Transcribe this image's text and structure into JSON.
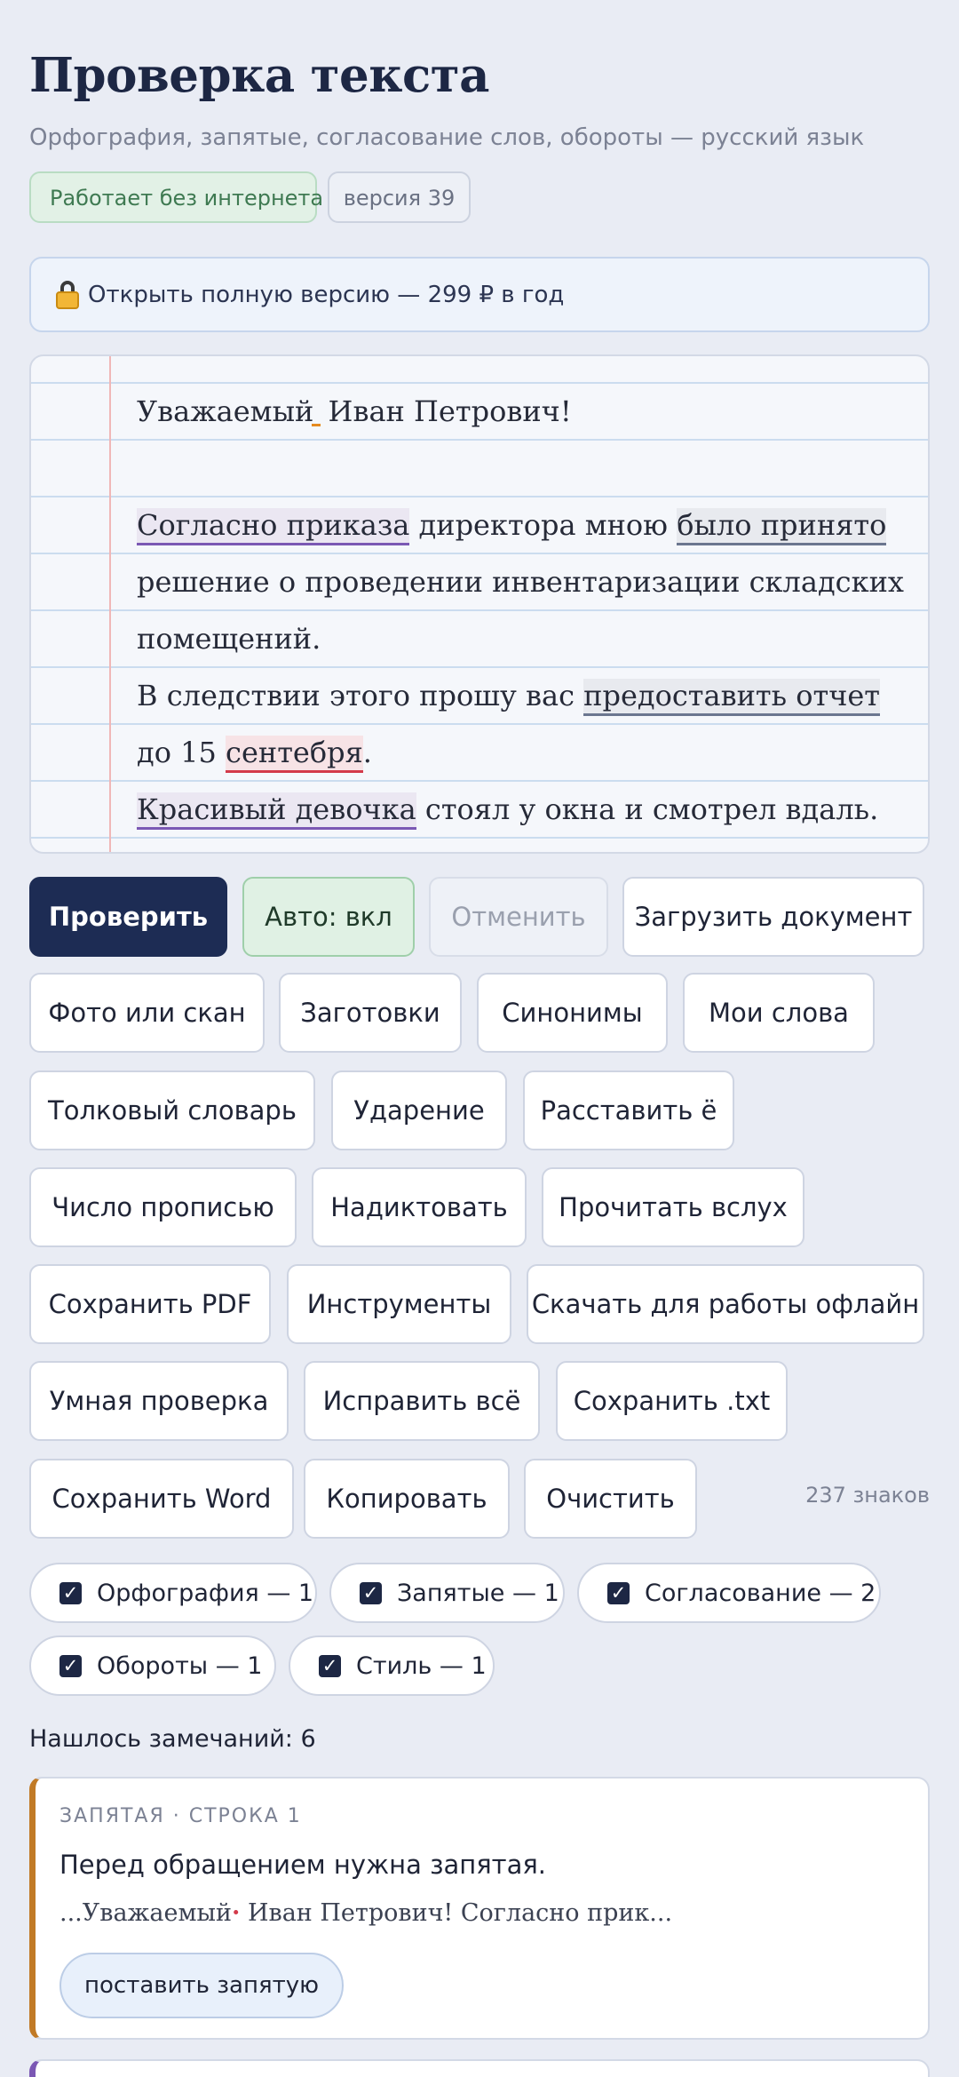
{
  "header": {
    "title": "Проверка текста",
    "subtitle": "Орфография, запятые, согласование слов, обороты — русский язык",
    "badge_offline": "Работает без интернета",
    "badge_version": "версия 39"
  },
  "promo": {
    "icon": "lock-icon",
    "label": "Открыть полную версию — 299 ₽ в год"
  },
  "editor": {
    "line1": {
      "before": "Уважаемый",
      "after": "Иван Петрович!"
    },
    "line3": {
      "hl1": "Согласно приказа",
      "mid": " директора мною ",
      "hl2": "было принято"
    },
    "line4": "решение о проведении инвентаризации складских",
    "line5": "помещений.",
    "line6": {
      "before": "В следствии этого прошу вас ",
      "hl": "предоставить отчет"
    },
    "line7": {
      "before": "до 15 ",
      "hl": "сентебря",
      "after": "."
    },
    "line8": {
      "hl": "Красивый девочка",
      "after": " стоял у окна и смотрел вдаль."
    }
  },
  "buttons": {
    "check": "Проверить",
    "auto": "Авто: вкл",
    "undo": "Отменить",
    "upload": "Загрузить документ",
    "photo": "Фото или скан",
    "templates": "Заготовки",
    "synonyms": "Синонимы",
    "my_words": "Мои слова",
    "dictionary": "Толковый словарь",
    "stress": "Ударение",
    "yo": "Расставить ё",
    "number_words": "Число прописью",
    "dictate": "Надиктовать",
    "read_aloud": "Прочитать вслух",
    "save_pdf": "Сохранить PDF",
    "tools": "Инструменты",
    "offline": "Скачать для работы офлайн",
    "smart": "Умная проверка",
    "fix_all": "Исправить всё",
    "save_txt": "Сохранить .txt",
    "save_word": "Сохранить Word",
    "copy": "Копировать",
    "clear": "Очистить"
  },
  "char_count": "237 знаков",
  "filters": [
    {
      "label": "Орфография — 1",
      "checked": true
    },
    {
      "label": "Запятые — 1",
      "checked": true
    },
    {
      "label": "Согласование — 2",
      "checked": true
    },
    {
      "label": "Обороты — 1",
      "checked": true
    },
    {
      "label": "Стиль — 1",
      "checked": true
    }
  ],
  "results": {
    "found_label": "Нашлось замечаний: 6",
    "issues": [
      {
        "meta": "ЗАПЯТАЯ · СТРОКА 1",
        "message": "Перед обращением нужна запятая.",
        "context_before": "...Уважаемый",
        "context_mark": "·",
        "context_after": " Иван Петрович! Согласно прик...",
        "fix_label": "поставить запятую",
        "accent": "#c17a26"
      }
    ]
  },
  "colors": {
    "primary": "#1d2c54",
    "background": "#e9ecf4",
    "agreement_highlight": "#7b58b4",
    "spelling_highlight": "#d33a4a",
    "comma_highlight": "#e58a1f"
  }
}
